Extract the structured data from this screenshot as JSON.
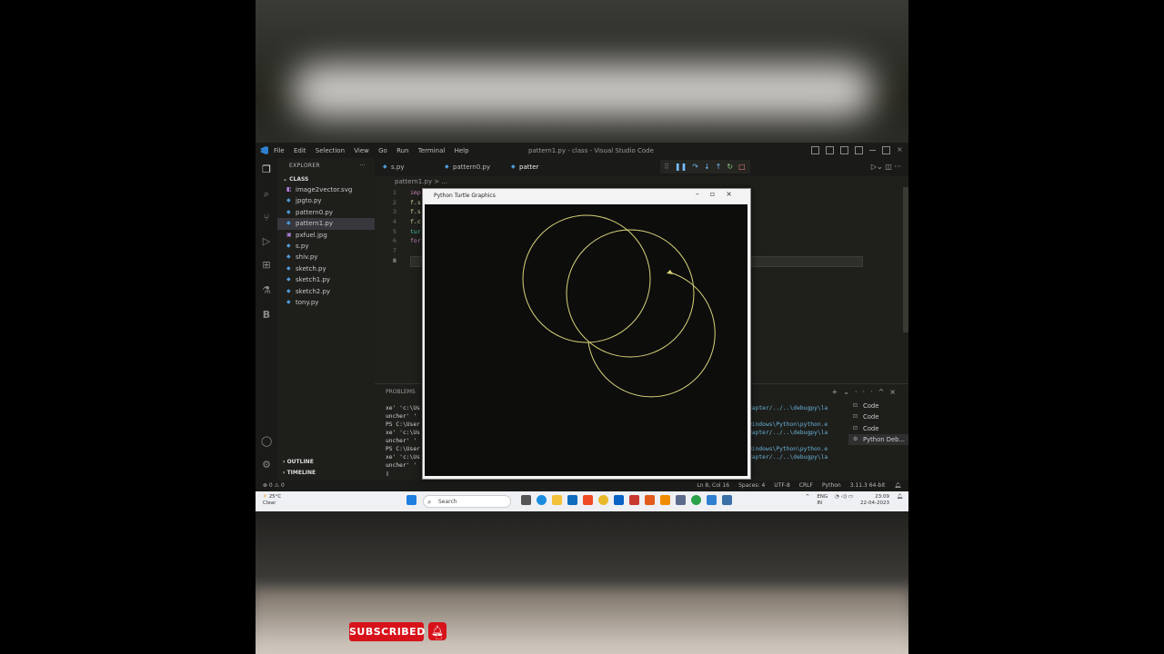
{
  "menu": [
    "File",
    "Edit",
    "Selection",
    "View",
    "Go",
    "Run",
    "Terminal",
    "Help"
  ],
  "window_title": "pattern1.py - class - Visual Studio Code",
  "explorer": {
    "header": "EXPLORER",
    "folder": "CLASS",
    "files": [
      "image2vector.svg",
      "jpgto.py",
      "pattern0.py",
      "pattern1.py",
      "pxfuel.jpg",
      "s.py",
      "shiv.py",
      "sketch.py",
      "sketch1.py",
      "sketch2.py",
      "tony.py"
    ],
    "sections": [
      "OUTLINE",
      "TIMELINE"
    ]
  },
  "tabs": [
    "s.py",
    "pattern0.py",
    "patter"
  ],
  "breadcrumb": "pattern1.py > ...",
  "line_numbers": [
    "1",
    "2",
    "3",
    "4",
    "5",
    "6",
    "7",
    "8"
  ],
  "code_lines": [
    "imp",
    "f.s",
    "f.s",
    "f.c",
    "tur",
    "for",
    "",
    ""
  ],
  "panel": {
    "tab": "PROBLEMS",
    "terminal_left": [
      "xe' 'c:\\Us",
      "uncher' '",
      "PS C:\\User",
      "xe' 'c:\\Us",
      "uncher' '",
      "PS C:\\User",
      "xe' 'c:\\Us",
      "uncher' '",
      "▯"
    ],
    "terminal_right": [
      "dapter/../..\\debugpy\\la",
      "",
      "windows\\Python\\python.e",
      "dapter/../..\\debugpy\\la",
      "",
      "windows\\Python\\python.e",
      "dapter/../..\\debugpy\\la"
    ],
    "terminals": [
      "Code",
      "Code",
      "Code",
      "Python Deb..."
    ]
  },
  "status": {
    "left": "⊗ 0 ⚠ 0",
    "right": [
      "Ln 8, Col 16",
      "Spaces: 4",
      "UTF-8",
      "CRLF",
      "Python",
      "3.11.3 64-bit"
    ]
  },
  "turtle": {
    "title": "Python Turtle Graphics",
    "stroke_color": "#d8d47a"
  },
  "taskbar": {
    "weather_temp": "25°C",
    "weather_desc": "Clear",
    "search": "Search",
    "lang1": "ENG",
    "lang2": "IN",
    "time": "23:09",
    "date": "22-04-2023"
  },
  "subscribe_label": "SUBSCRIBED"
}
